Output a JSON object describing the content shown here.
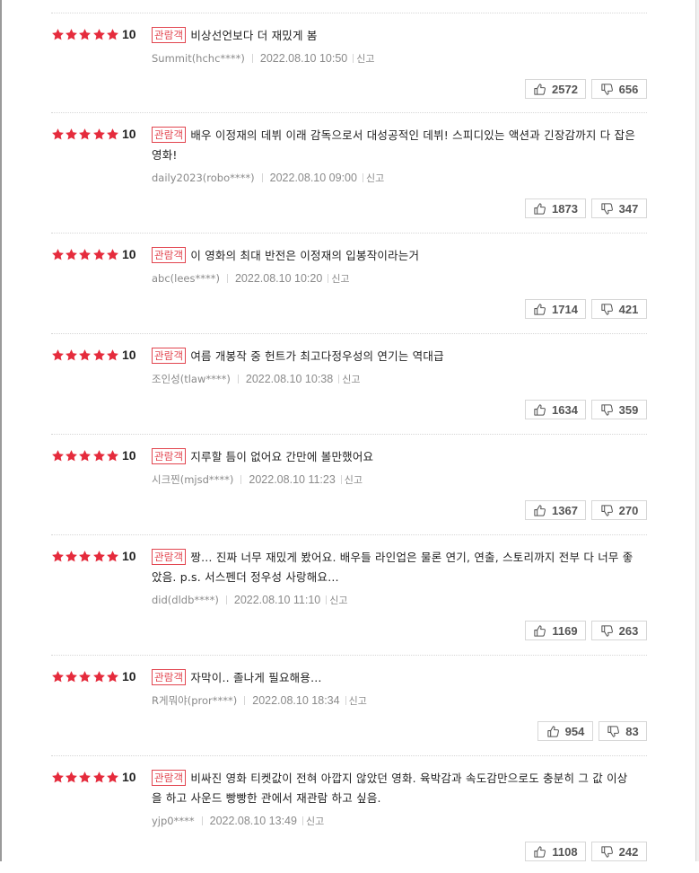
{
  "colors": {
    "star": "#e52b3c",
    "badge": "#e2454f",
    "border": "#d7d7d7"
  },
  "icons": {
    "rating": "star-icon",
    "like": "thumbs-up-icon",
    "dislike": "thumbs-down-icon"
  },
  "reviews": [
    {
      "stars": 5,
      "score": "10",
      "badge": "관람객",
      "text": "비상선언보다 더 재밌게 봄",
      "user": "Summit(hchc****)",
      "date": "2022.08.10 10:50",
      "report": "신고",
      "likes": "2572",
      "dislikes": "656"
    },
    {
      "stars": 5,
      "score": "10",
      "badge": "관람객",
      "text": "배우 이정재의 데뷔 이래 감독으로서 대성공적인 데뷔! 스피디있는 액션과 긴장감까지 다 잡은 영화!",
      "user": "daily2023(robo****)",
      "date": "2022.08.10 09:00",
      "report": "신고",
      "likes": "1873",
      "dislikes": "347"
    },
    {
      "stars": 5,
      "score": "10",
      "badge": "관람객",
      "text": "이 영화의 최대 반전은 이정재의 입봉작이라는거",
      "user": "abc(lees****)",
      "date": "2022.08.10 10:20",
      "report": "신고",
      "likes": "1714",
      "dislikes": "421"
    },
    {
      "stars": 5,
      "score": "10",
      "badge": "관람객",
      "text": "여름 개봉작 중 헌트가 최고다정우성의 연기는 역대급",
      "user": "조인성(tlaw****)",
      "date": "2022.08.10 10:38",
      "report": "신고",
      "likes": "1634",
      "dislikes": "359"
    },
    {
      "stars": 5,
      "score": "10",
      "badge": "관람객",
      "text": "지루할 틈이 없어요 간만에 볼만했어요",
      "user": "시크찐(mjsd****)",
      "date": "2022.08.10 11:23",
      "report": "신고",
      "likes": "1367",
      "dislikes": "270"
    },
    {
      "stars": 5,
      "score": "10",
      "badge": "관람객",
      "text": "짱… 진짜 너무 재밌게 봤어요. 배우들 라인업은 물론 연기, 연출, 스토리까지 전부 다 너무 좋았음. p.s. 서스펜더 정우성 사랑해요…",
      "user": "did(dldb****)",
      "date": "2022.08.10 11:10",
      "report": "신고",
      "likes": "1169",
      "dislikes": "263"
    },
    {
      "stars": 5,
      "score": "10",
      "badge": "관람객",
      "text": "자막이.. 졸나게 필요해용…",
      "user": "R게뭐야(pror****)",
      "date": "2022.08.10 18:34",
      "report": "신고",
      "likes": "954",
      "dislikes": "83"
    },
    {
      "stars": 5,
      "score": "10",
      "badge": "관람객",
      "text": "비싸진 영화 티켓값이 전혀 아깝지 않았던 영화. 육박감과 속도감만으로도 충분히 그 값 이상을 하고 사운드 빵빵한 관에서 재관람 하고 싶음.",
      "user": "yjp0****",
      "date": "2022.08.10 13:49",
      "report": "신고",
      "likes": "1108",
      "dislikes": "242"
    }
  ]
}
